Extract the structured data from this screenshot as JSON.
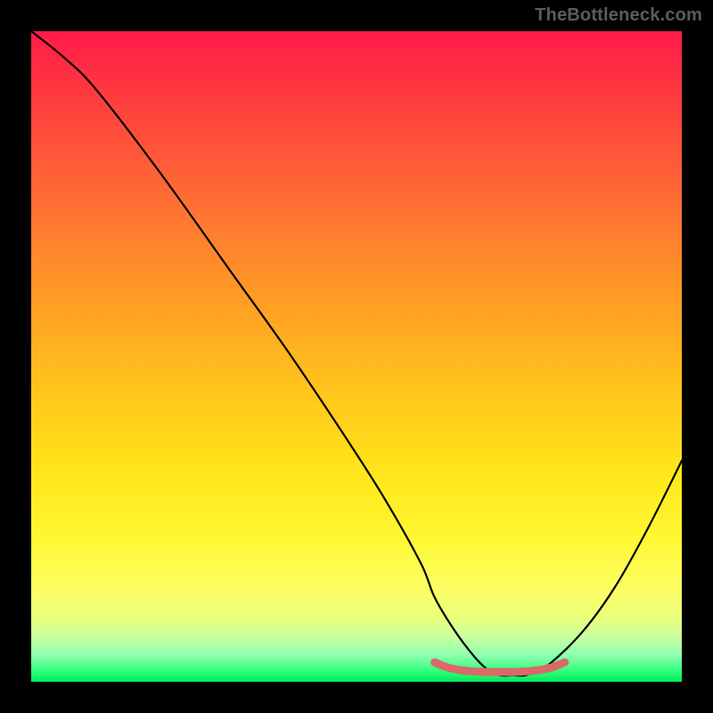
{
  "watermark": "TheBottleneck.com",
  "chart_data": {
    "type": "line",
    "title": "",
    "xlabel": "",
    "ylabel": "",
    "xlim": [
      0,
      100
    ],
    "ylim": [
      0,
      100
    ],
    "series": [
      {
        "name": "bottleneck-curve",
        "x": [
          0,
          5,
          10,
          20,
          30,
          40,
          50,
          55,
          60,
          62,
          65,
          68,
          70,
          72,
          74,
          76,
          78,
          80,
          85,
          90,
          95,
          100
        ],
        "values": [
          100,
          96,
          91,
          78,
          64,
          50,
          35,
          27,
          18,
          13,
          8,
          4,
          2,
          1,
          1,
          1,
          2,
          3,
          8,
          15,
          24,
          34
        ]
      },
      {
        "name": "sweet-spot-marker",
        "x": [
          62,
          64,
          66,
          68,
          70,
          72,
          74,
          76,
          78,
          80,
          82
        ],
        "values": [
          3.0,
          2.2,
          1.8,
          1.6,
          1.5,
          1.5,
          1.5,
          1.6,
          1.8,
          2.2,
          3.0
        ]
      }
    ],
    "gradient_stops": [
      {
        "pct": 0,
        "color": "#ff1a49"
      },
      {
        "pct": 10,
        "color": "#ff3b3f"
      },
      {
        "pct": 25,
        "color": "#ff6a35"
      },
      {
        "pct": 40,
        "color": "#ff9926"
      },
      {
        "pct": 55,
        "color": "#ffc41c"
      },
      {
        "pct": 68,
        "color": "#ffe61a"
      },
      {
        "pct": 78,
        "color": "#fff833"
      },
      {
        "pct": 86,
        "color": "#fbff66"
      },
      {
        "pct": 90,
        "color": "#eaff7a"
      },
      {
        "pct": 93,
        "color": "#ccffa0"
      },
      {
        "pct": 96,
        "color": "#8cffb0"
      },
      {
        "pct": 98.5,
        "color": "#2bff76"
      },
      {
        "pct": 100,
        "color": "#00e85b"
      }
    ],
    "marker_color": "#d86a6a"
  }
}
